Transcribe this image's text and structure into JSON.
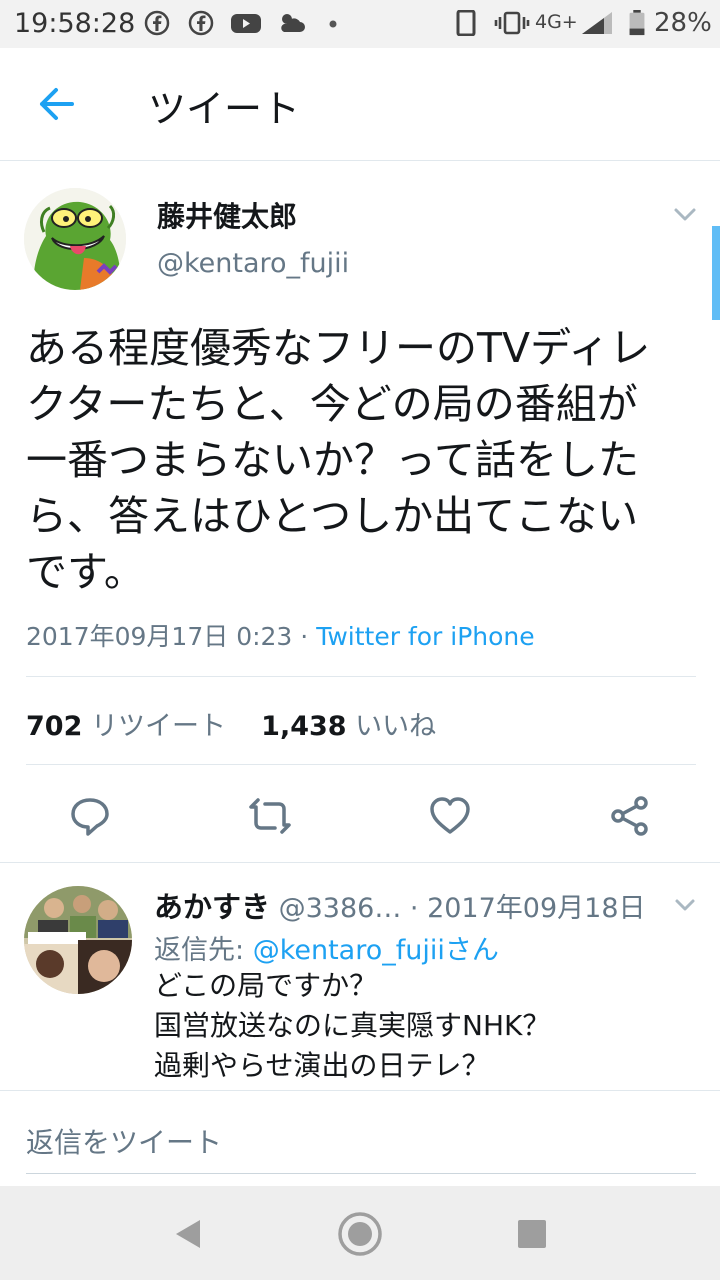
{
  "status_bar": {
    "time": "19:58:28",
    "network": "4G+",
    "battery": "28%",
    "icons": [
      "facebook-icon",
      "facebook-icon",
      "youtube-icon",
      "weather-icon",
      "dot-icon",
      "phone-icon",
      "vibrate-icon",
      "signal-icon",
      "battery-icon"
    ]
  },
  "header": {
    "title": "ツイート",
    "back_icon": "back-arrow-icon"
  },
  "tweet": {
    "name": "藤井健太郎",
    "handle": "@kentaro_fujii",
    "lines": [
      "ある程度優秀なフリーのTVディレ",
      "クターたちと、今どの局の番組が",
      "一番つまらないか？って話をした",
      "ら、答えはひとつしか出てこない",
      "です。"
    ],
    "timestamp": "2017年09月17日 0:23",
    "separator": " · ",
    "source": "Twitter for iPhone",
    "retweet_count": "702",
    "retweet_label": "リツイート",
    "like_count": "1,438",
    "like_label": "いいね"
  },
  "actions": [
    "reply-icon",
    "retweet-icon",
    "like-icon",
    "share-icon"
  ],
  "reply": {
    "name": "あかすき",
    "handle": "@3386…",
    "date": " · 2017年09月18日",
    "reply_to_prefix": "返信先: ",
    "reply_to_handle": "@kentaro_fujiiさん",
    "lines": [
      "どこの局ですか？",
      "国営放送なのに真実隠すNHK？",
      "過剰やらせ演出の日テレ？"
    ]
  },
  "compose": {
    "placeholder": "返信をツイート"
  },
  "colors": {
    "accent": "#1da1f2",
    "secondary_text": "#657786",
    "primary_text": "#14171a"
  }
}
